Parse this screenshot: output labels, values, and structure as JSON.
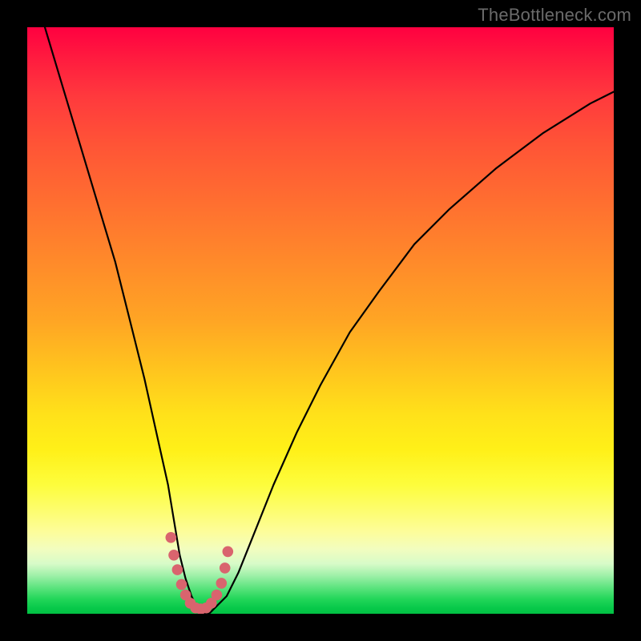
{
  "watermark": {
    "text": "TheBottleneck.com"
  },
  "chart_data": {
    "type": "line",
    "title": "",
    "xlabel": "",
    "ylabel": "",
    "xlim": [
      0,
      100
    ],
    "ylim": [
      0,
      100
    ],
    "annotations": [],
    "series": [
      {
        "name": "bottleneck-curve",
        "x": [
          3,
          6,
          9,
          12,
          15,
          18,
          20,
          22,
          24,
          25,
          26,
          27,
          28,
          29,
          30,
          31,
          32,
          34,
          36,
          38,
          42,
          46,
          50,
          55,
          60,
          66,
          72,
          80,
          88,
          96,
          100
        ],
        "values": [
          100,
          90,
          80,
          70,
          60,
          48,
          40,
          31,
          22,
          16,
          10,
          6,
          3,
          1,
          0,
          0,
          1,
          3,
          7,
          12,
          22,
          31,
          39,
          48,
          55,
          63,
          69,
          76,
          82,
          87,
          89
        ]
      }
    ],
    "markers": {
      "name": "optimal-region",
      "color": "#d9646e",
      "x": [
        24.5,
        25.0,
        25.6,
        26.3,
        27.0,
        27.8,
        28.7,
        29.6,
        30.5,
        31.4,
        32.3,
        33.1,
        33.7,
        34.2
      ],
      "values": [
        13.0,
        10.0,
        7.5,
        5.0,
        3.2,
        1.8,
        1.0,
        0.8,
        1.0,
        1.8,
        3.2,
        5.2,
        7.8,
        10.6
      ]
    },
    "background": {
      "type": "vertical-gradient",
      "description": "color scale from red (high bottleneck) at top through orange/yellow to green (balanced) at bottom"
    }
  }
}
